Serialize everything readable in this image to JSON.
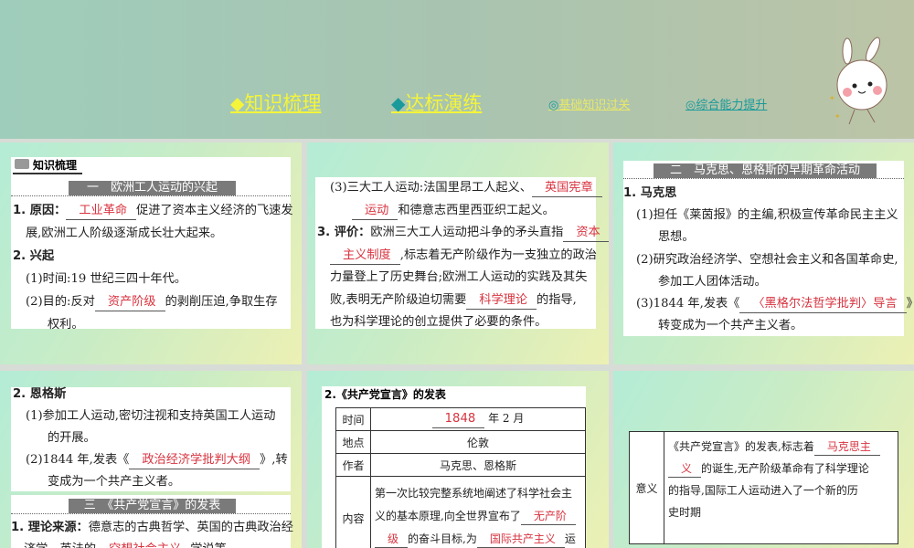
{
  "nav": {
    "knowledge": "知识梳理",
    "practice": "达标演练",
    "basic": "基础知识过关",
    "ability": "综合能力提升",
    "knowledge_color": "#f4f43a",
    "diamond1_color": "#f4f43a",
    "diamond2_color": "#1a9a9a"
  },
  "logo": "知识梳理",
  "sections": {
    "s1": "一　欧洲工人运动的兴起",
    "s2": "二　马克思、恩格斯的早期革命活动",
    "s3": "三　《共产党宣言》的发表"
  },
  "panels": {
    "p1": [
      [
        {
          "b": "1. 原因："
        },
        {
          "a": "工业革命"
        },
        {
          "t": "促进了资本主义经济的飞速发"
        }
      ],
      [
        {
          "i": 1
        },
        {
          "t": "展,欧洲工人阶级逐渐成长壮大起来。"
        }
      ],
      [
        {
          "b": "2. 兴起"
        }
      ],
      [
        {
          "i": 1
        },
        {
          "t": "(1)时间:19 世纪三四十年代。"
        }
      ],
      [
        {
          "i": 1
        },
        {
          "t": "(2)目的:反对"
        },
        {
          "a": "资产阶级"
        },
        {
          "t": "的剥削压迫,争取生存"
        }
      ],
      [
        {
          "i": 2
        },
        {
          "t": "权利。"
        }
      ]
    ],
    "p2": [
      [
        {
          "i": 1
        },
        {
          "t": "(3)三大工人运动:法国里昂工人起义、"
        },
        {
          "a": "英国宪章"
        }
      ],
      [
        {
          "i": 2
        },
        {
          "a": "运动"
        },
        {
          "t": "和德意志西里西亚织工起义。"
        }
      ],
      [
        {
          "b": "3. 评价："
        },
        {
          "t": "欧洲三大工人运动把斗争的矛头直指"
        },
        {
          "a": "资本"
        }
      ],
      [
        {
          "i": 1
        },
        {
          "a": "主义制度"
        },
        {
          "t": ",标志着无产阶级作为一支独立的政治"
        }
      ],
      [
        {
          "i": 1
        },
        {
          "t": "力量登上了历史舞台;欧洲工人运动的实践及其失"
        }
      ],
      [
        {
          "i": 1
        },
        {
          "t": "败,表明无产阶级迫切需要"
        },
        {
          "a": "科学理论"
        },
        {
          "t": "的指导,"
        }
      ],
      [
        {
          "i": 1
        },
        {
          "t": "也为科学理论的创立提供了必要的条件。"
        }
      ]
    ],
    "p3": [
      [
        {
          "b": "1. 马克思"
        }
      ],
      [
        {
          "i": 1
        },
        {
          "t": "(1)担任《莱茵报》的主编,积极宣传革命民主主义"
        }
      ],
      [
        {
          "i": 2
        },
        {
          "t": "思想。"
        }
      ],
      [
        {
          "i": 1
        },
        {
          "t": "(2)研究政治经济学、空想社会主义和各国革命史,"
        }
      ],
      [
        {
          "i": 2
        },
        {
          "t": "参加工人团体活动。"
        }
      ],
      [
        {
          "i": 1
        },
        {
          "t": "(3)1844 年,发表《"
        },
        {
          "a": "〈黑格尔法哲学批判〉导言"
        },
        {
          "t": "》,"
        }
      ],
      [
        {
          "i": 2
        },
        {
          "t": "转变成为一个共产主义者。"
        }
      ]
    ],
    "p4": [
      [
        {
          "b": "2. 恩格斯"
        }
      ],
      [
        {
          "i": 1
        },
        {
          "t": "(1)参加工人运动,密切注视和支持英国工人运动"
        }
      ],
      [
        {
          "i": 2
        },
        {
          "t": "的开展。"
        }
      ],
      [
        {
          "i": 1
        },
        {
          "t": "(2)1844 年,发表《"
        },
        {
          "a": "政治经济学批判大纲"
        },
        {
          "t": "》,转"
        }
      ],
      [
        {
          "i": 2
        },
        {
          "t": "变成为一个共产主义者。"
        }
      ]
    ],
    "p4b": [
      [
        {
          "b": "1. 理论来源："
        },
        {
          "t": "德意志的古典哲学、英国的古典政治经"
        }
      ],
      [
        {
          "i": 1
        },
        {
          "t": "济学、英法的"
        },
        {
          "a": "空想社会主义"
        },
        {
          "t": "学说等。"
        }
      ]
    ],
    "p5title": "2.《共产党宣言》的发表",
    "table": {
      "time_label": "时间",
      "time_answer": "1848",
      "time_rest": "年 2 月",
      "place_label": "地点",
      "place": "伦敦",
      "author_label": "作者",
      "author": "马克思、恩格斯",
      "content_label": "内容",
      "content": [
        [
          {
            "t": "第一次比较完整系统地阐述了科学社会主"
          }
        ],
        [
          {
            "t": "义的基本原理,向全世界宣布了"
          },
          {
            "a": "无产阶"
          }
        ],
        [
          {
            "a": "级"
          },
          {
            "t": "的奋斗目标,为"
          },
          {
            "a": "国际共产主义"
          },
          {
            "t": "运"
          }
        ]
      ],
      "meaning_label": "意义",
      "meaning": [
        [
          {
            "t": "《共产党宣言》的发表,标志着"
          },
          {
            "a": "马克思主"
          }
        ],
        [
          {
            "a": "义"
          },
          {
            "t": "的诞生,无产阶级革命有了科学理论"
          }
        ],
        [
          {
            "t": "的指导,国际工人运动进入了一个新的历"
          }
        ],
        [
          {
            "t": "史时期"
          }
        ]
      ]
    }
  }
}
